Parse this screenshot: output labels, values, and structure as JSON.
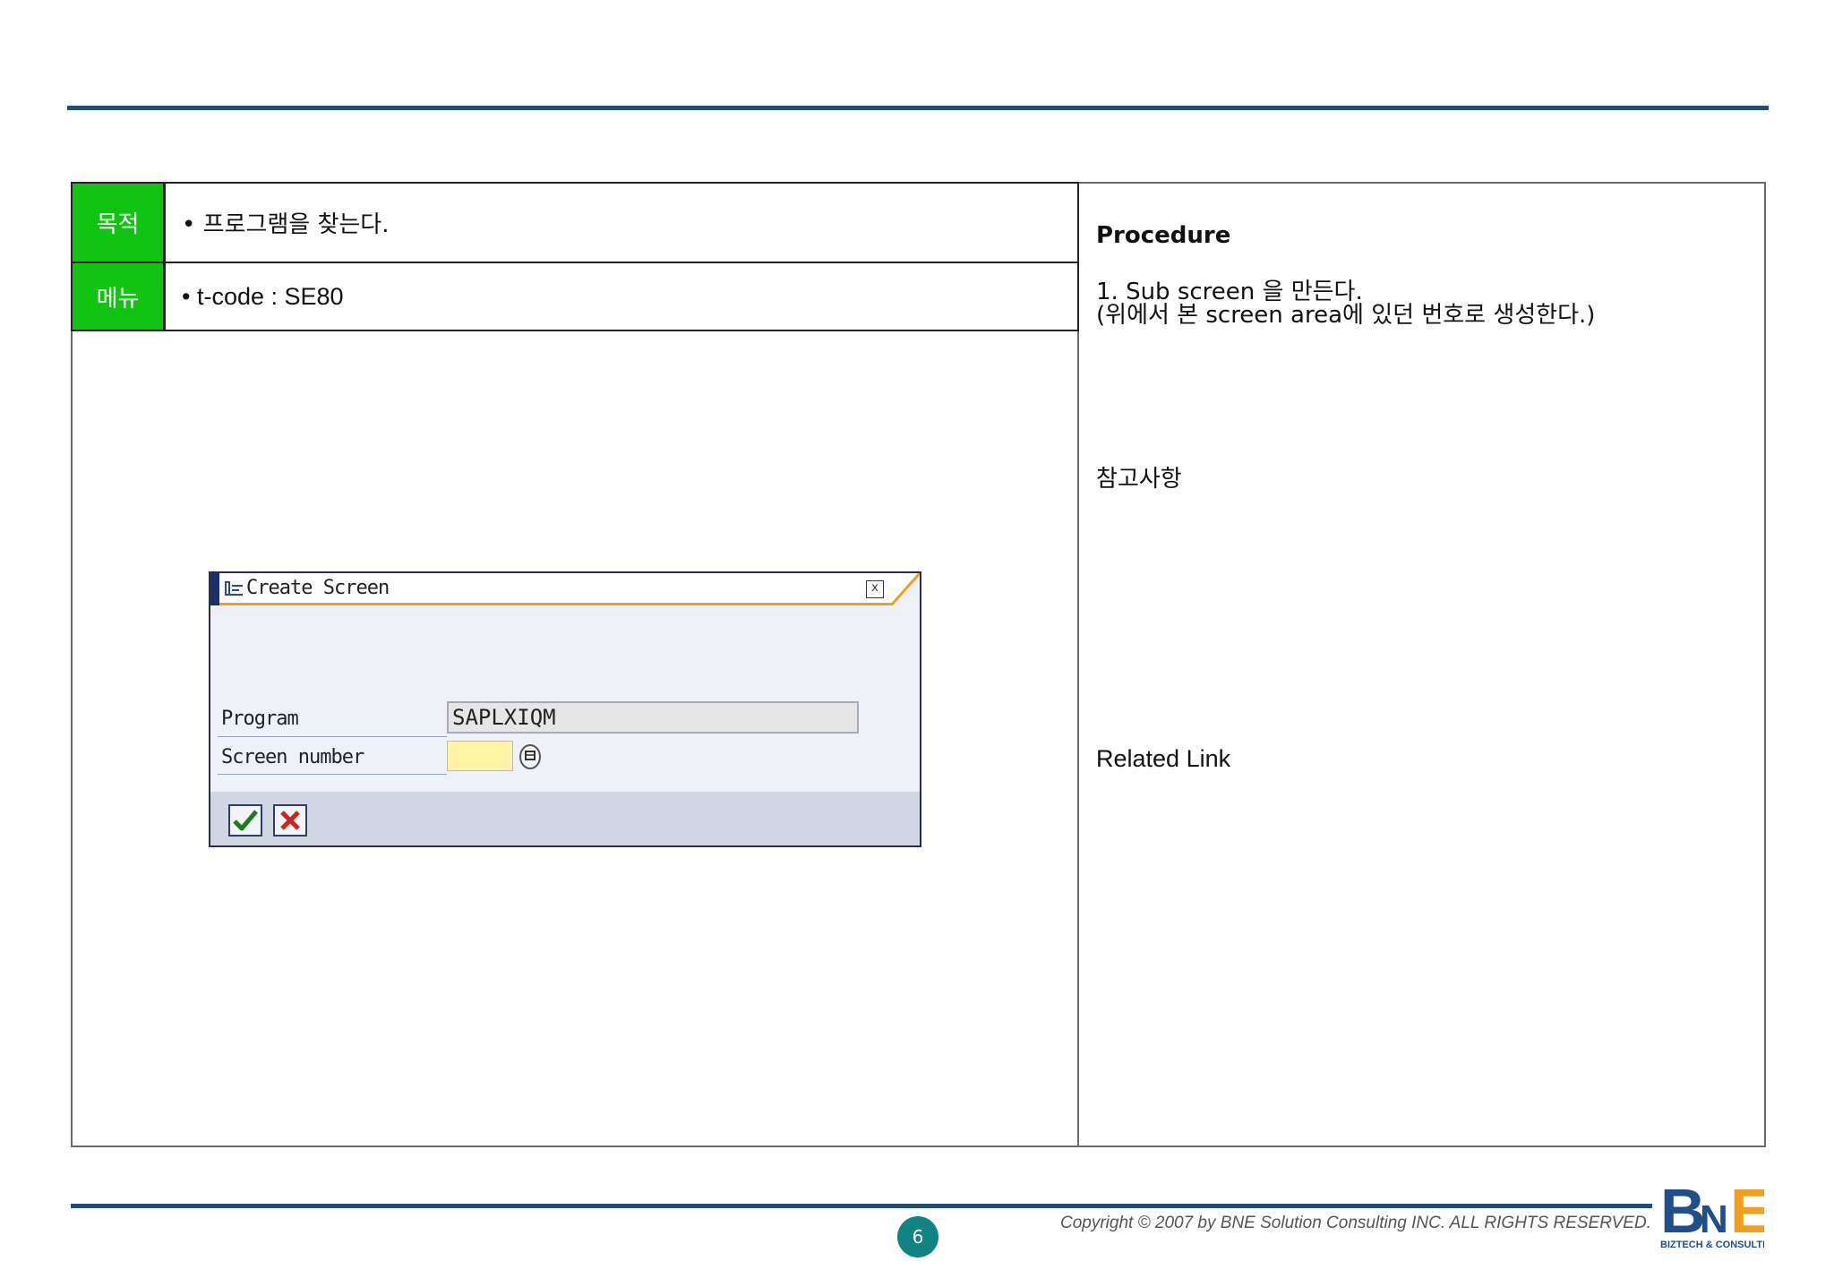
{
  "table": {
    "purpose_label": "목적",
    "purpose_value": "• 프로그램을 찾는다.",
    "menu_label": "메뉴",
    "menu_value": "• t-code : SE80"
  },
  "right_panel": {
    "procedure_title": "Procedure",
    "procedure_line1": "1. Sub screen 을 만든다.",
    "procedure_line2": "(위에서 본 screen area에 있던 번호로 생성한다.)",
    "reference_title": "참고사항",
    "related_link_title": "Related Link"
  },
  "dialog": {
    "title": "Create Screen",
    "close_glyph": "x",
    "program_label": "Program",
    "program_value": "SAPLXIQM",
    "screen_number_label": "Screen number",
    "screen_number_value": "",
    "ok_icon": "check-icon",
    "cancel_icon": "cancel-x-icon"
  },
  "footer": {
    "page_number": "6",
    "copyright": "Copyright © 2007 by BNE Solution Consulting INC.   ALL RIGHTS RESERVED.",
    "logo_text": "BNE",
    "logo_sub": "BIZTECH & CONSULTING"
  },
  "colors": {
    "label_green": "#11c411",
    "rule_blue": "#1f4e6e",
    "page_badge": "#128383",
    "dialog_accent": "#f0a020",
    "input_yellow": "#fff3a8"
  }
}
